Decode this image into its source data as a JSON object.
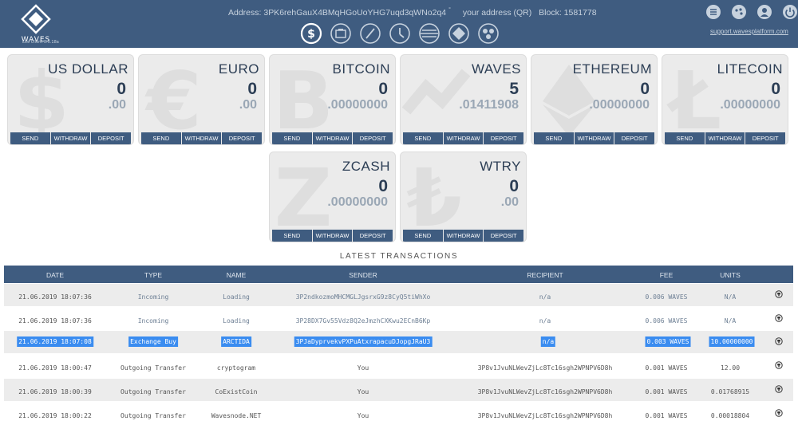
{
  "header": {
    "logo_text": "WAVES",
    "logo_sub": "Lite Client 0.5.18a",
    "address_label": "Address: 3PK6rehGauX4BMqHGoUoYHG7uqd3qWNo2q4",
    "address_suffix": "°",
    "qr_label": "your address (QR)",
    "block_label": "Block: 1581778",
    "support_link": "support.wavesplatform.com",
    "nav_icons": [
      "wallet-dollar-icon",
      "briefcase-icon",
      "blocked-icon",
      "clock-icon",
      "exchange-lines-icon",
      "waves-diamond-icon",
      "community-icon"
    ],
    "right_icons": [
      "settings-sliders-icon",
      "palette-icon",
      "user-icon",
      "power-icon"
    ]
  },
  "cards": [
    {
      "name": "US DOLLAR",
      "int": "0",
      "dec": ".00",
      "glyph": "$",
      "send": "SEND",
      "withdraw": "WITHDRAW",
      "deposit": "DEPOSIT"
    },
    {
      "name": "EURO",
      "int": "0",
      "dec": ".00",
      "glyph": "€",
      "send": "SEND",
      "withdraw": "WITHDRAW",
      "deposit": "DEPOSIT"
    },
    {
      "name": "BITCOIN",
      "int": "0",
      "dec": ".00000000",
      "glyph": "B",
      "send": "SEND",
      "withdraw": "WITHDRAW",
      "deposit": "DEPOSIT"
    },
    {
      "name": "WAVES",
      "int": "5",
      "dec": ".01411908",
      "glyph": "≈",
      "send": "SEND",
      "withdraw": "WITHDRAW",
      "deposit": "DEPOSIT"
    },
    {
      "name": "ETHEREUM",
      "int": "0",
      "dec": ".00000000",
      "glyph": "◆",
      "send": "SEND",
      "withdraw": "WITHDRAW",
      "deposit": "DEPOSIT"
    },
    {
      "name": "LITECOIN",
      "int": "0",
      "dec": ".00000000",
      "glyph": "Ł",
      "send": "SEND",
      "withdraw": "WITHDRAW",
      "deposit": "DEPOSIT"
    },
    {
      "name": "ZCASH",
      "int": "0",
      "dec": ".00000000",
      "glyph": "Z",
      "send": "SEND",
      "withdraw": "WITHDRAW",
      "deposit": "DEPOSIT"
    },
    {
      "name": "WTRY",
      "int": "0",
      "dec": ".00",
      "glyph": "₺",
      "send": "SEND",
      "withdraw": "WITHDRAW",
      "deposit": "DEPOSIT"
    }
  ],
  "transactions": {
    "title": "LATEST TRANSACTIONS",
    "columns": {
      "date": "DATE",
      "type": "TYPE",
      "name": "NAME",
      "sender": "SENDER",
      "recipient": "RECIPIENT",
      "fee": "FEE",
      "units": "UNITS"
    },
    "rows": [
      {
        "date": "21.06.2019 18:07:36",
        "type": "Incoming",
        "name": "Loading",
        "sender": "3P2ndkozmoMHCMGLJgsrxG9z8CyQ5tiWhXo",
        "recipient": "n/a",
        "fee": "0.006 WAVES",
        "units": "N/A",
        "selected": false
      },
      {
        "date": "21.06.2019 18:07:36",
        "type": "Incoming",
        "name": "Loading",
        "sender": "3P28DX7Gv55Vdz8Q2eJmzhCXKwu2ECnB6Kp",
        "recipient": "n/a",
        "fee": "0.006 WAVES",
        "units": "N/A",
        "selected": false
      },
      {
        "date": "21.06.2019 18:07:08",
        "type": "Exchange Buy",
        "name": "ARCTIDA",
        "sender": "3PJaDyprvekvPXPuAtxrapacuDJopgJRaU3",
        "recipient": "n/a",
        "fee": "0.003 WAVES",
        "units": "10.00000000",
        "selected": true
      },
      {
        "date": "21.06.2019 18:00:47",
        "type": "Outgoing Transfer",
        "name": "cryptogram",
        "sender": "You",
        "recipient": "3P8v1JvuNLWevZjLc8Tc16sgh2WPNPV6D8h",
        "fee": "0.001 WAVES",
        "units": "12.00",
        "selected": false
      },
      {
        "date": "21.06.2019 18:00:39",
        "type": "Outgoing Transfer",
        "name": "CoExistCoin",
        "sender": "You",
        "recipient": "3P8v1JvuNLWevZjLc8Tc16sgh2WPNPV6D8h",
        "fee": "0.001 WAVES",
        "units": "0.01768915",
        "selected": false
      },
      {
        "date": "21.06.2019 18:00:22",
        "type": "Outgoing Transfer",
        "name": "Wavesnode.NET",
        "sender": "You",
        "recipient": "3P8v1JvuNLWevZjLc8Tc16sgh2WPNPV6D8h",
        "fee": "0.001 WAVES",
        "units": "0.00018804",
        "selected": false
      }
    ]
  },
  "colors": {
    "header_bg": "#3f5c80",
    "selection": "#3a8cf0",
    "card_bg": "#ebebeb"
  }
}
